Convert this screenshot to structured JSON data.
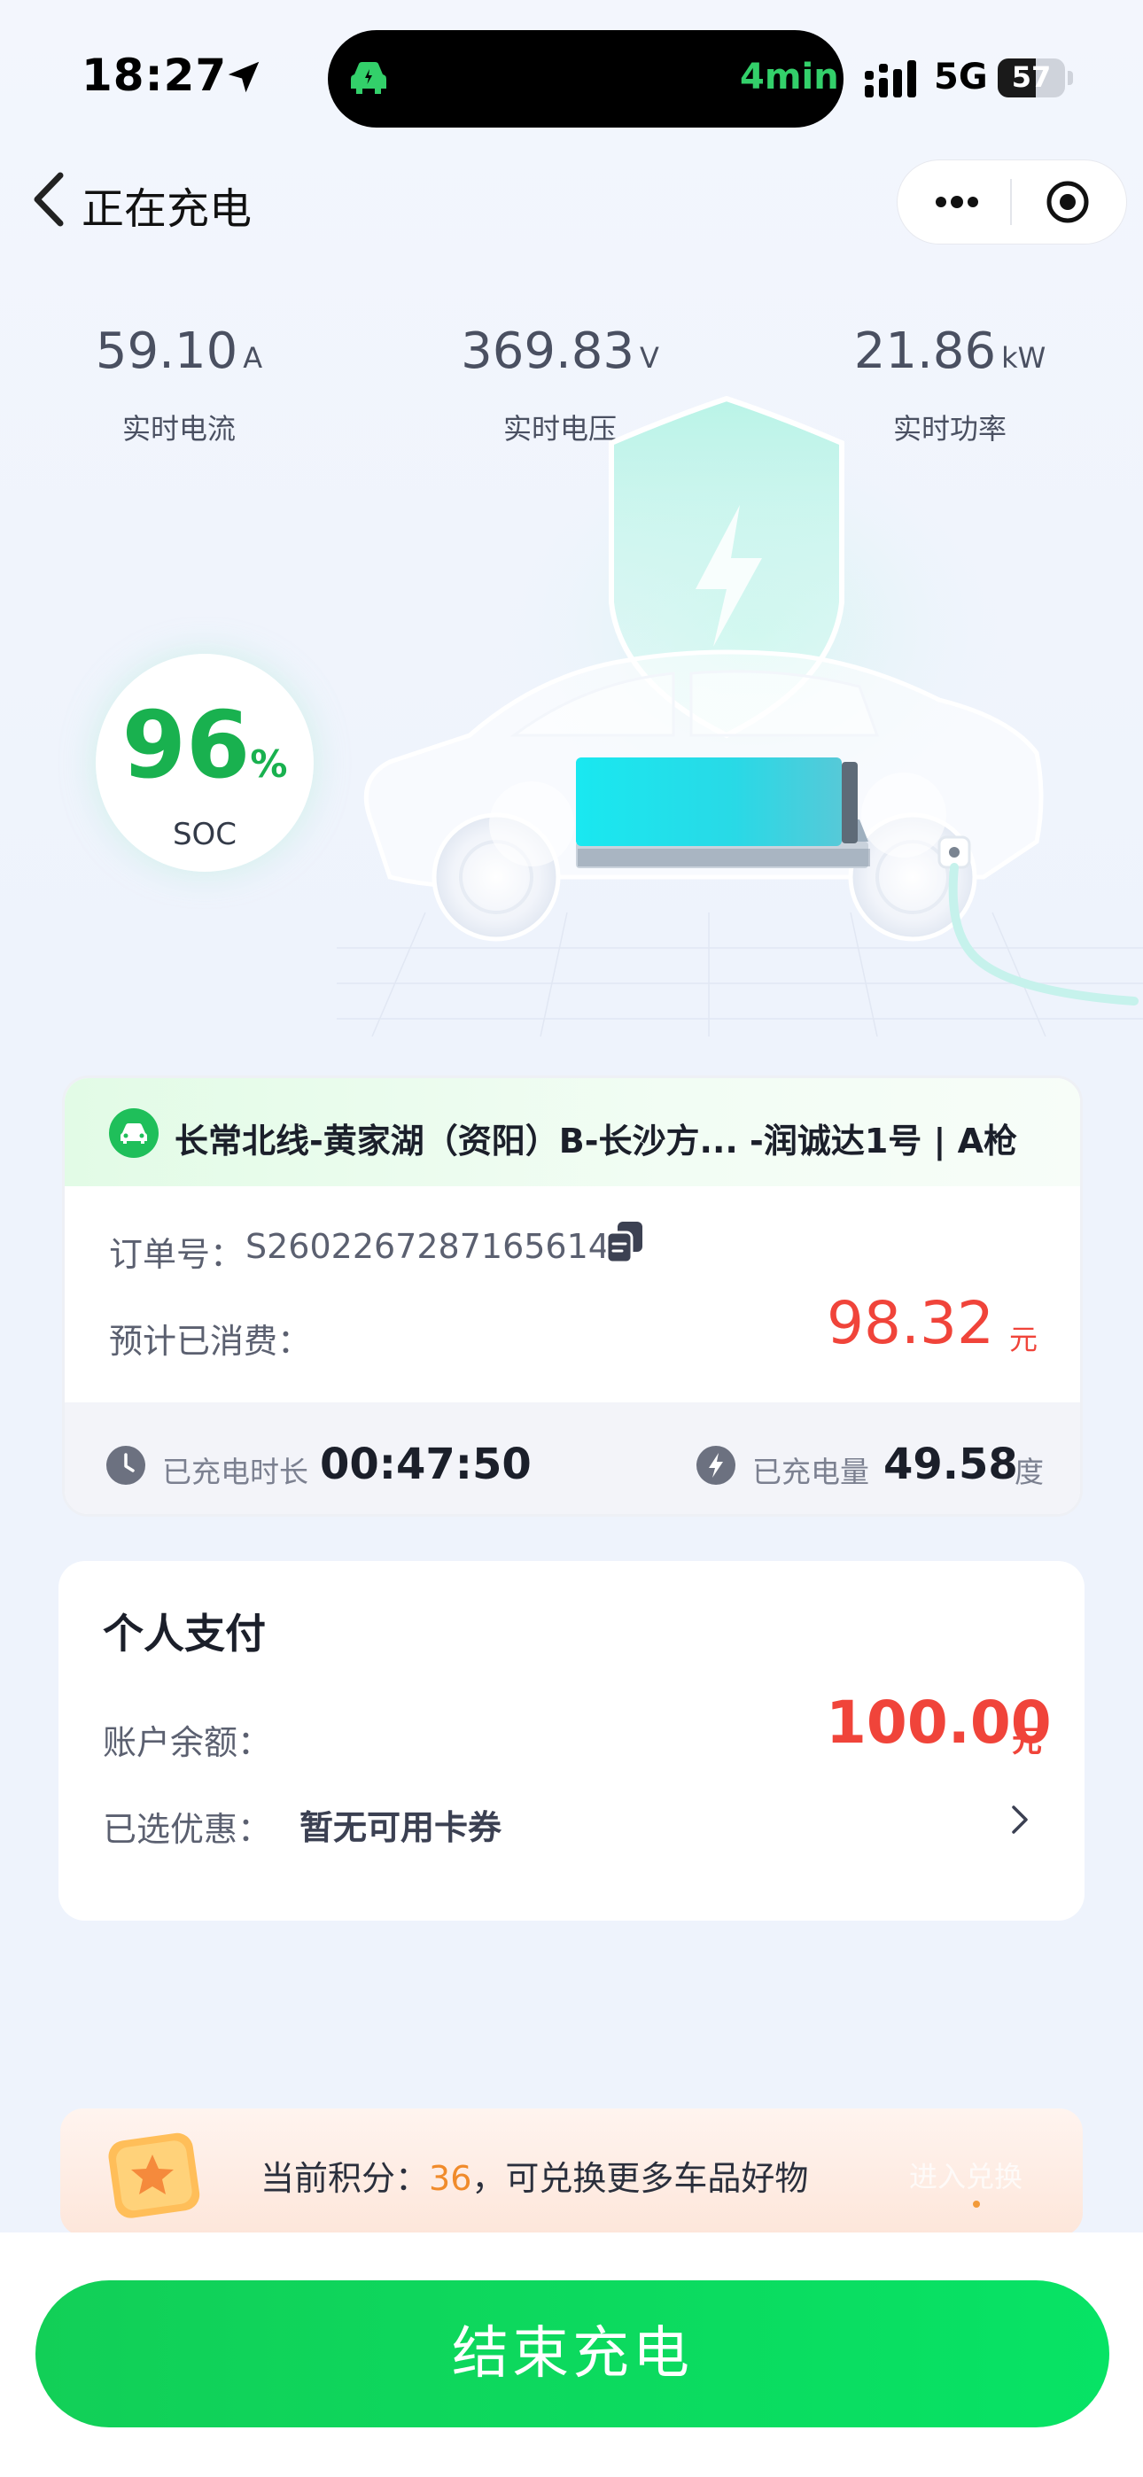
{
  "status_bar": {
    "time": "18:27",
    "activity_text": "4min",
    "network": "5G",
    "battery": "57",
    "battery_fraction": 0.57
  },
  "nav": {
    "title": "正在充电"
  },
  "stats": [
    {
      "value": "59.10",
      "unit": "A",
      "label": "实时电流"
    },
    {
      "value": "369.83",
      "unit": "V",
      "label": "实时电压"
    },
    {
      "value": "21.86",
      "unit": "kW",
      "label": "实时功率"
    }
  ],
  "soc": {
    "value": "96",
    "unit": "%",
    "label": "SOC"
  },
  "station": {
    "name": "长常北线-黄家湖（资阳）B-长沙方... -润诚达1号 | A枪",
    "order_label": "订单号：",
    "order_number": "S26022672871656141",
    "consumed_label": "预计已消费：",
    "consumed_value": "98.32",
    "consumed_unit": "元",
    "duration_label": "已充电时长",
    "duration_value": "00:47:50",
    "energy_label": "已充电量",
    "energy_value": "49.58",
    "energy_unit": "度"
  },
  "payment": {
    "title": "个人支付",
    "balance_label": "账户余额：",
    "balance_value": "100.00",
    "balance_unit": "元",
    "coupon_label": "已选优惠：",
    "coupon_value": "暂无可用卡券"
  },
  "points": {
    "prefix": "当前积分：",
    "value": "36",
    "suffix": "，可兑换更多车品好物",
    "link": "进入兑换"
  },
  "end_button": "结束充电",
  "colors": {
    "green": "#19b14f",
    "red": "#f0443a",
    "orange": "#f08b2b"
  }
}
